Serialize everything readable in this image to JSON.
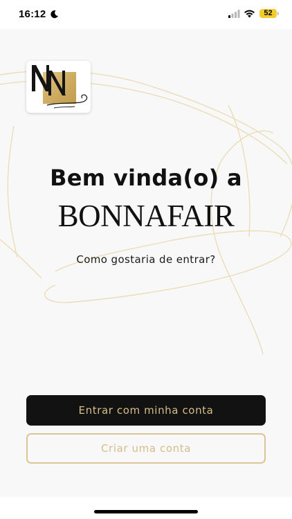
{
  "status_bar": {
    "time": "16:12",
    "battery_level": "52",
    "icons": [
      "moon-icon",
      "signal-icon",
      "wifi-icon",
      "battery-icon"
    ]
  },
  "welcome": {
    "greeting": "Bem vinda(o) a",
    "brand": "BONNAFAIR",
    "question": "Como gostaria de entrar?"
  },
  "actions": {
    "login_label": "Entrar com minha conta",
    "create_label": "Criar uma conta"
  },
  "colors": {
    "gold": "#d9bf86",
    "dark_button": "#121212",
    "background": "#f8f8f8"
  }
}
